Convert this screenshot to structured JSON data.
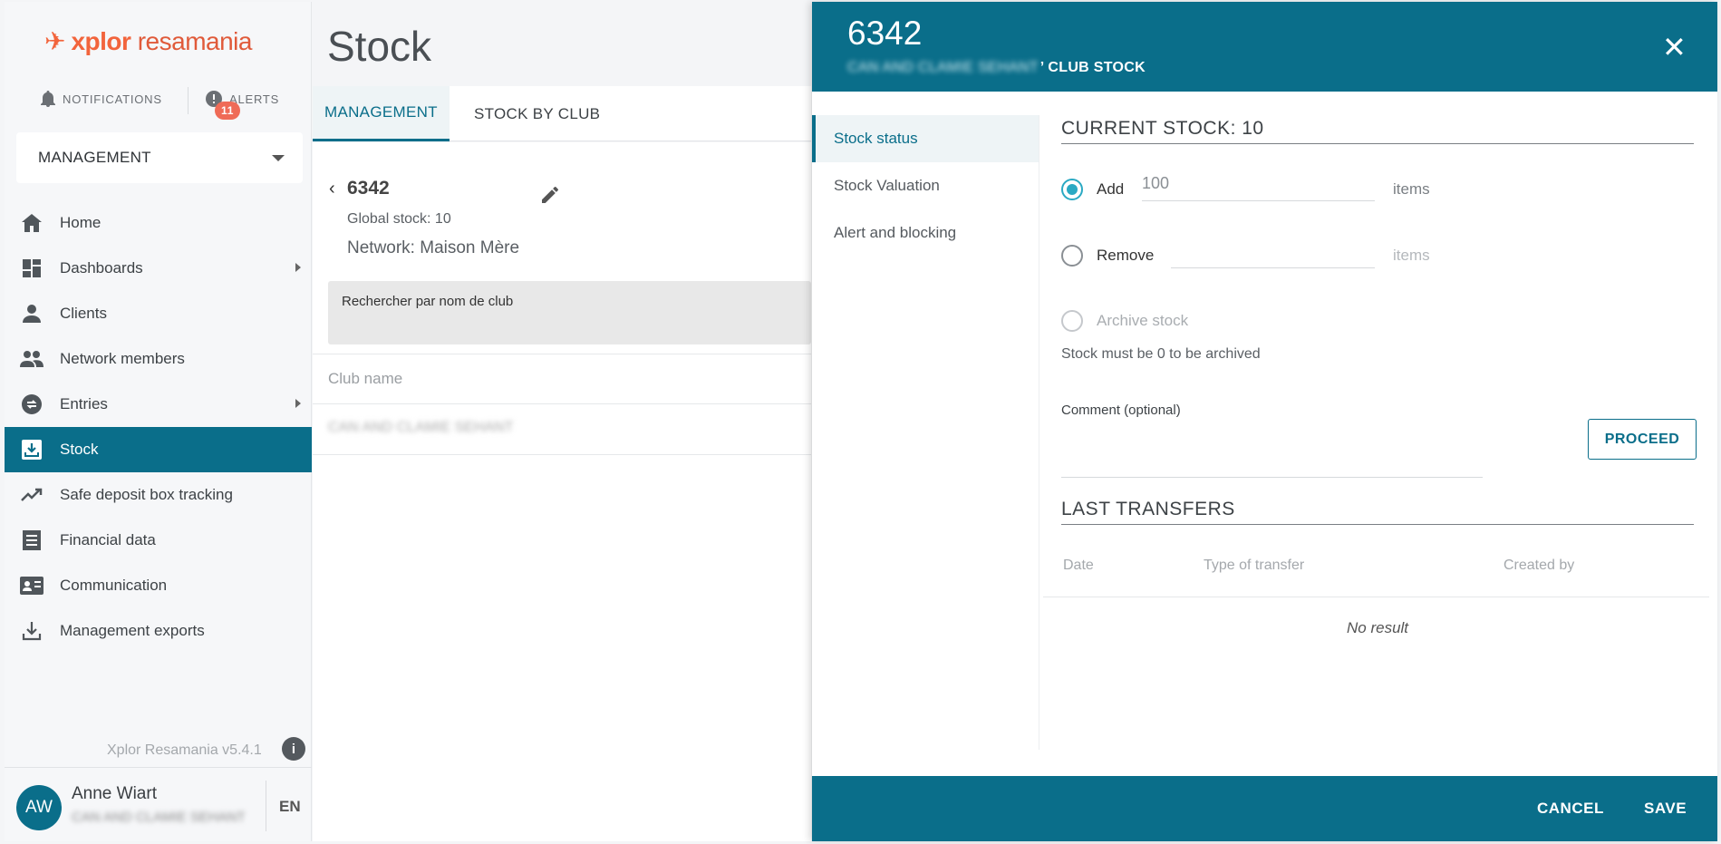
{
  "sidebar": {
    "logo_mark": "✈",
    "logo_brand": "xplor",
    "logo_product": "resamania",
    "notifications_label": "NOTIFICATIONS",
    "alerts_label": "ALERTS",
    "alerts_count": "11",
    "space_selector": "MANAGEMENT",
    "items": [
      {
        "label": "Home",
        "icon": "home-icon"
      },
      {
        "label": "Dashboards",
        "icon": "dashboard-icon",
        "has_submenu": true
      },
      {
        "label": "Clients",
        "icon": "person-icon"
      },
      {
        "label": "Network members",
        "icon": "people-icon"
      },
      {
        "label": "Entries",
        "icon": "swap-icon",
        "has_submenu": true
      },
      {
        "label": "Stock",
        "icon": "stock-icon",
        "active": true
      },
      {
        "label": "Safe deposit box tracking",
        "icon": "trend-icon"
      },
      {
        "label": "Financial data",
        "icon": "receipt-icon"
      },
      {
        "label": "Communication",
        "icon": "contact-card-icon"
      },
      {
        "label": "Management exports",
        "icon": "download-icon"
      }
    ],
    "version": "Xplor Resamania v5.4.1",
    "user": {
      "initials": "AW",
      "name": "Anne Wiart",
      "club": "CAN AND CLAMIE SEHANT",
      "lang": "EN"
    }
  },
  "main": {
    "title": "Stock",
    "tabs": [
      {
        "label": "MANAGEMENT",
        "active": true
      },
      {
        "label": "STOCK BY CLUB"
      }
    ],
    "product_code": "6342",
    "global_stock": "Global stock: 10",
    "network": "Network: Maison Mère",
    "search_placeholder": "Rechercher par nom de club",
    "column_club_name": "Club name",
    "row_club": "CAN AND CLAMIE SEHANT"
  },
  "panel": {
    "title": "6342",
    "subtitle_club": "CAN AND CLAMIE SEHANT",
    "subtitle_suffix": "’ CLUB STOCK",
    "nav": [
      {
        "label": "Stock status",
        "active": true
      },
      {
        "label": "Stock Valuation"
      },
      {
        "label": "Alert and blocking"
      }
    ],
    "current_stock": "CURRENT STOCK: 10",
    "add_label": "Add",
    "add_value": "100",
    "remove_label": "Remove",
    "remove_value": "",
    "items_unit": "items",
    "archive_label": "Archive stock",
    "archive_hint": "Stock must be 0 to be archived",
    "comment_label": "Comment (optional)",
    "proceed": "PROCEED",
    "last_transfers": "LAST TRANSFERS",
    "col_date": "Date",
    "col_type": "Type of transfer",
    "col_created": "Created by",
    "no_result": "No result",
    "cancel": "CANCEL",
    "save": "SAVE"
  },
  "colors": {
    "accent": "#0a6e8a",
    "radio": "#2aa9c3",
    "badge": "#ef6b57",
    "brand": "#f2643c"
  }
}
